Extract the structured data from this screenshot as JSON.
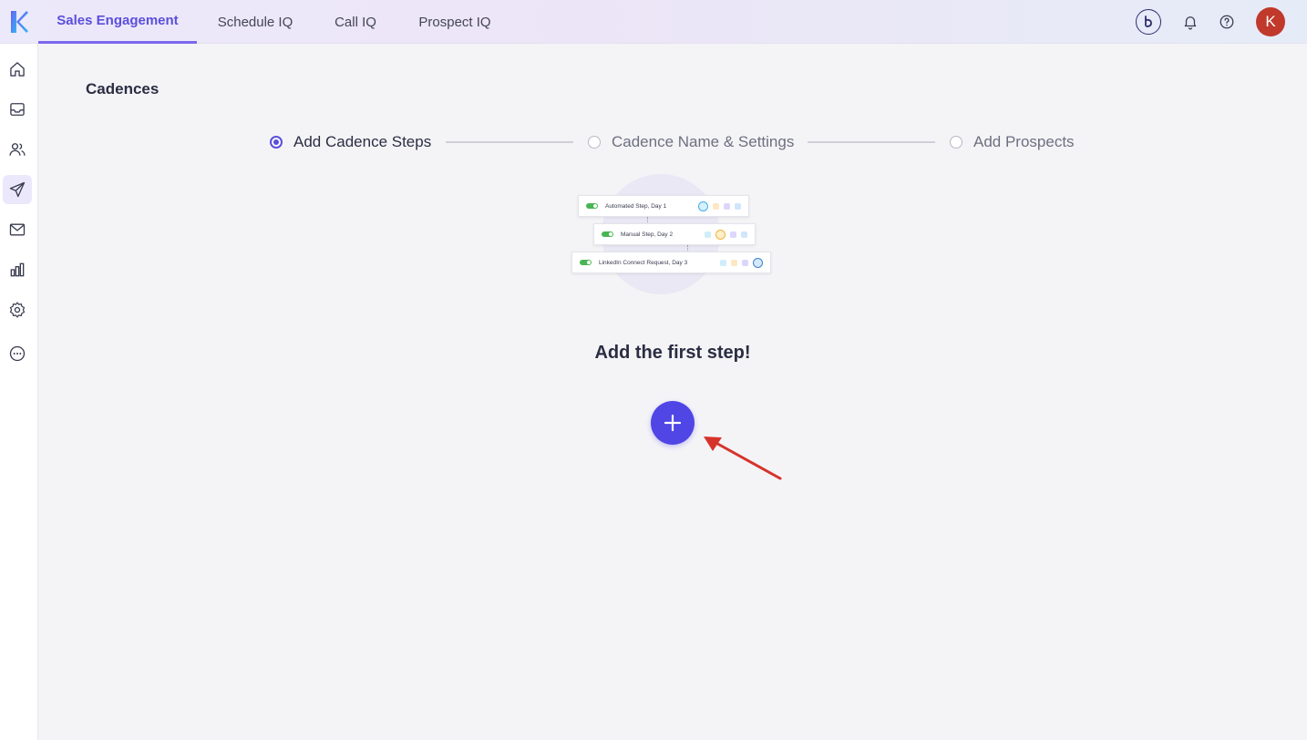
{
  "nav": {
    "tabs": [
      {
        "label": "Sales Engagement",
        "active": true
      },
      {
        "label": "Schedule IQ",
        "active": false
      },
      {
        "label": "Call IQ",
        "active": false
      },
      {
        "label": "Prospect IQ",
        "active": false
      }
    ],
    "avatar_initial": "K",
    "accent_color": "#5b4fdb"
  },
  "sidebar": {
    "items": [
      "home-icon",
      "inbox-icon",
      "people-icon",
      "send-icon",
      "mail-icon",
      "bar-chart-icon",
      "gear-icon",
      "more-icon"
    ],
    "active": "send-icon"
  },
  "page": {
    "title": "Cadences"
  },
  "stepper": {
    "steps": [
      {
        "label": "Add Cadence Steps",
        "active": true
      },
      {
        "label": "Cadence Name & Settings",
        "active": false
      },
      {
        "label": "Add Prospects",
        "active": false
      }
    ]
  },
  "illustration": {
    "cards": [
      {
        "label": "Automated Step, Day 1"
      },
      {
        "label": "Manual Step, Day 2"
      },
      {
        "label": "LinkedIn Connect Request, Day 3"
      }
    ]
  },
  "empty_state": {
    "title": "Add the first step!",
    "add_button_icon": "plus-icon",
    "button_color": "#4f46e5"
  }
}
